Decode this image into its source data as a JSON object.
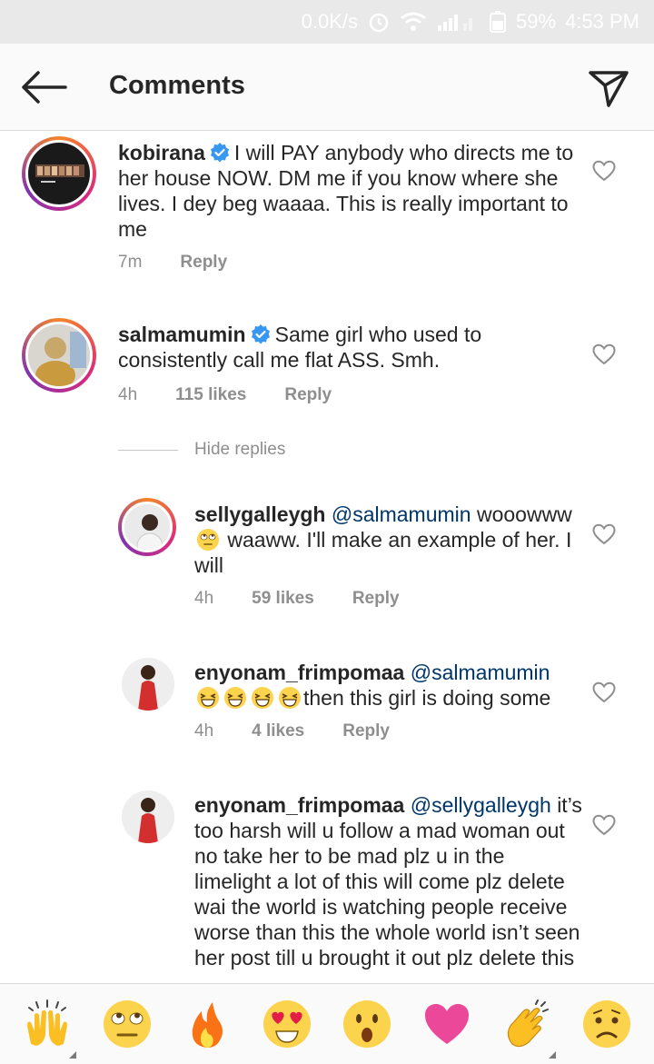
{
  "status_bar": {
    "speed": "0.0K/s",
    "battery": "59%",
    "time": "4:53 PM"
  },
  "header": {
    "title": "Comments"
  },
  "comments": [
    {
      "username": "kobirana",
      "verified": true,
      "text": "I will PAY anybody who directs me to her house NOW. DM me if you know where she lives. I dey beg waaaa. This is really important to me",
      "time": "7m",
      "likes": "",
      "reply_label": "Reply"
    },
    {
      "username": "salmamumin",
      "verified": true,
      "text": "Same girl who used to consistently call me flat ASS. Smh.",
      "time": "4h",
      "likes": "115 likes",
      "reply_label": "Reply"
    }
  ],
  "hide_replies_label": "Hide replies",
  "replies": [
    {
      "username": "sellygalleygh",
      "mention": "@salmamumin",
      "text_a": "wooowww",
      "text_b": "waaww. I'll make an example of her. I will",
      "time": "4h",
      "likes": "59 likes",
      "reply_label": "Reply"
    },
    {
      "username": "enyonam_frimpomaa",
      "mention": "@salmamumin",
      "text": "then this girl is doing some",
      "time": "4h",
      "likes": "4 likes",
      "reply_label": "Reply"
    },
    {
      "username": "enyonam_frimpomaa",
      "mention": "@sellygalleygh",
      "text": "it’s too harsh will u follow a mad woman out no take her to be mad plz u in the limelight a lot of this will come plz delete wai the world is watching people receive worse than this the whole world isn’t seen her post till u brought it out plz delete this"
    }
  ],
  "emoji_bar": [
    "raised-hands",
    "eye-roll",
    "fire",
    "heart-eyes",
    "surprised",
    "heart",
    "clapping",
    "sad"
  ],
  "colors": {
    "verified_blue": "#3897f0",
    "mention": "#003569",
    "meta_gray": "#8e8e8e"
  }
}
